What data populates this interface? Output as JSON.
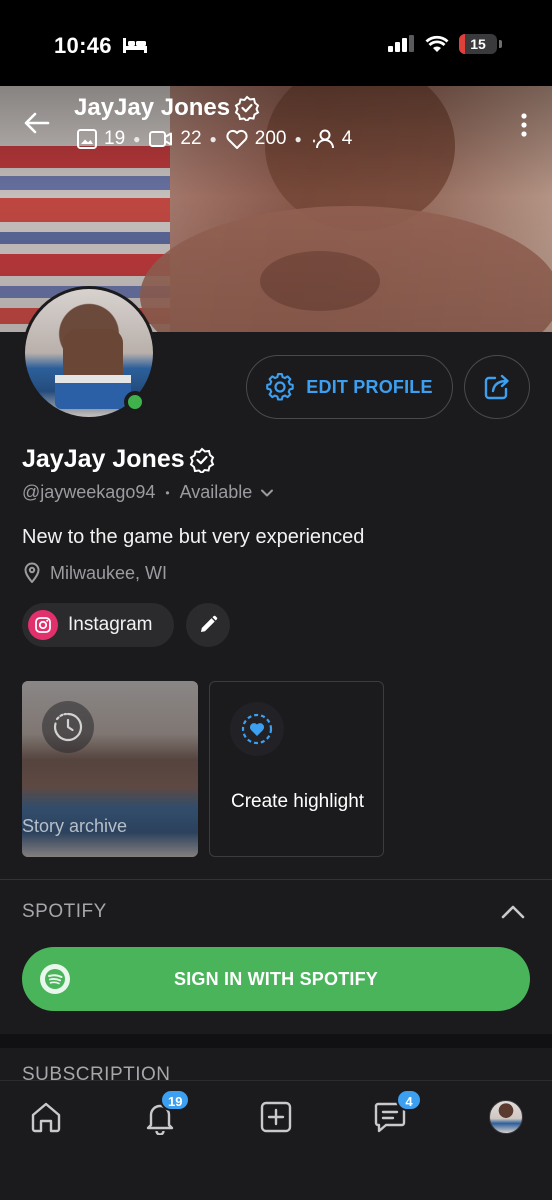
{
  "status_bar": {
    "time": "10:46",
    "battery": "15",
    "battery_level": 0.15
  },
  "cover": {
    "name": "JayJay Jones",
    "stats": {
      "photos": "19",
      "videos": "22",
      "likes": "200",
      "subscribers": "4"
    }
  },
  "profile": {
    "edit_label": "EDIT PROFILE",
    "name": "JayJay Jones",
    "handle": "@jayweekago94",
    "separator": "•",
    "availability": "Available",
    "bio": "New to the game but very experienced",
    "location": "Milwaukee, WI",
    "online": true
  },
  "links": {
    "instagram_label": "Instagram"
  },
  "stories": {
    "archive_label": "Story archive",
    "highlight_label": "Create highlight"
  },
  "spotify": {
    "section_title": "SPOTIFY",
    "signin_label": "SIGN IN WITH SPOTIFY"
  },
  "subscription": {
    "section_title": "SUBSCRIPTION"
  },
  "tab_bar": {
    "notifications_badge": "19",
    "messages_badge": "4"
  },
  "colors": {
    "accent": "#3d9ff0",
    "spotify": "#4ab45b",
    "online": "#3fb24c",
    "instagram": "#e1306c",
    "background": "#1b1b1d"
  }
}
